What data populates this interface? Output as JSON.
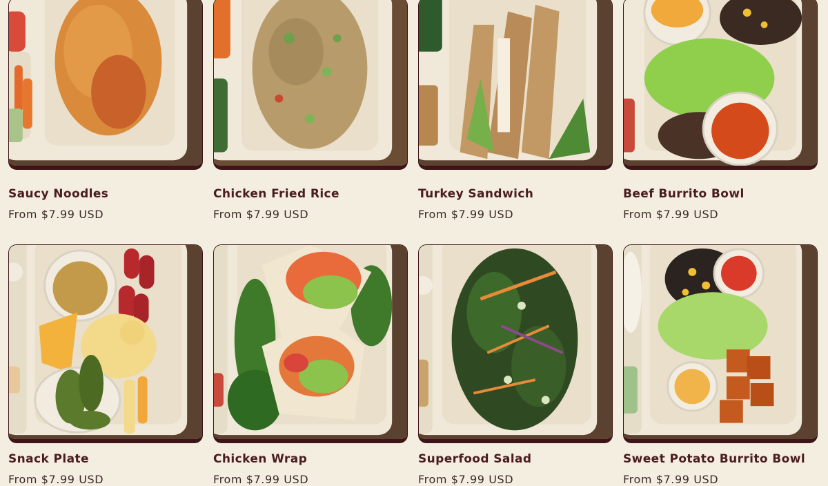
{
  "products": [
    {
      "title": "Saucy Noodles",
      "price": "From $7.99 USD"
    },
    {
      "title": "Chicken Fried Rice",
      "price": "From $7.99 USD"
    },
    {
      "title": "Turkey Sandwich",
      "price": "From $7.99 USD"
    },
    {
      "title": "Beef Burrito Bowl",
      "price": "From $7.99 USD"
    },
    {
      "title": "Snack Plate",
      "price": "From $7.99 USD"
    },
    {
      "title": "Chicken Wrap",
      "price": "From $7.99 USD"
    },
    {
      "title": "Superfood Salad",
      "price": "From $7.99 USD"
    },
    {
      "title": "Sweet Potato Burrito Bowl",
      "price": "From $7.99 USD"
    }
  ]
}
